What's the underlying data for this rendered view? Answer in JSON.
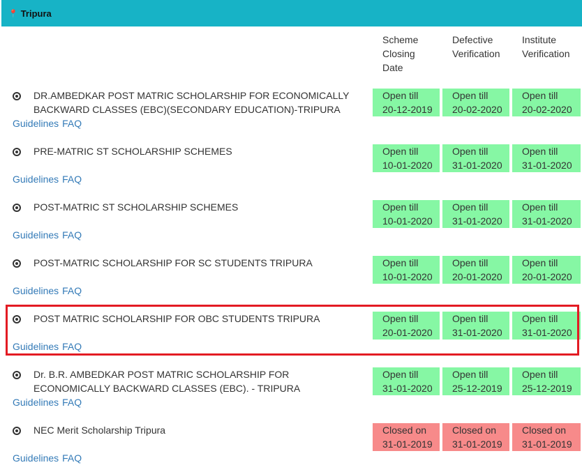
{
  "header": {
    "title": "Tripura",
    "icon": "map-pin-icon"
  },
  "columns": [
    "Scheme Closing Date",
    "Defective Verification",
    "Institute Verification"
  ],
  "column_lines": [
    [
      "Scheme",
      "Closing",
      "Date"
    ],
    [
      "Defective",
      "Verification"
    ],
    [
      "Institute",
      "Verification"
    ]
  ],
  "links": {
    "guidelines": "Guidelines",
    "faq": "FAQ"
  },
  "schemes": [
    {
      "title": "DR.AMBEDKAR POST MATRIC SCHOLARSHIP FOR ECONOMICALLY BACKWARD CLASSES (EBC)(SECONDARY EDUCATION)-TRIPURA",
      "status": [
        [
          "Open till",
          "20-12-2019"
        ],
        [
          "Open till",
          "20-02-2020"
        ],
        [
          "Open till",
          "20-02-2020"
        ]
      ],
      "state": "open"
    },
    {
      "title": "PRE-MATRIC ST SCHOLARSHIP SCHEMES",
      "status": [
        [
          "Open till",
          "10-01-2020"
        ],
        [
          "Open till",
          "31-01-2020"
        ],
        [
          "Open till",
          "31-01-2020"
        ]
      ],
      "state": "open"
    },
    {
      "title": "POST-MATRIC ST SCHOLARSHIP SCHEMES",
      "status": [
        [
          "Open till",
          "10-01-2020"
        ],
        [
          "Open till",
          "31-01-2020"
        ],
        [
          "Open till",
          "31-01-2020"
        ]
      ],
      "state": "open"
    },
    {
      "title": "POST-MATRIC SCHOLARSHIP FOR SC STUDENTS TRIPURA",
      "status": [
        [
          "Open till",
          "10-01-2020"
        ],
        [
          "Open till",
          "20-01-2020"
        ],
        [
          "Open till",
          "20-01-2020"
        ]
      ],
      "state": "open"
    },
    {
      "title": "POST MATRIC SCHOLARSHIP FOR OBC STUDENTS TRIPURA",
      "status": [
        [
          "Open till",
          "20-01-2020"
        ],
        [
          "Open till",
          "31-01-2020"
        ],
        [
          "Open till",
          "31-01-2020"
        ]
      ],
      "state": "open"
    },
    {
      "title": "Dr. B.R. AMBEDKAR POST MATRIC SCHOLARSHIP FOR ECONOMICALLY BACKWARD CLASSES (EBC). - TRIPURA",
      "status": [
        [
          "Open till",
          "31-01-2020"
        ],
        [
          "Open till",
          "25-12-2019"
        ],
        [
          "Open till",
          "25-12-2019"
        ]
      ],
      "state": "open"
    },
    {
      "title": "NEC Merit Scholarship Tripura",
      "status": [
        [
          "Closed on",
          "31-01-2019"
        ],
        [
          "Closed on",
          "31-01-2019"
        ],
        [
          "Closed on",
          "31-01-2019"
        ]
      ],
      "state": "closed"
    }
  ],
  "colors": {
    "header": "#17b3c6",
    "open": "#86f7a4",
    "closed": "#f78a8a",
    "link": "#337ab7",
    "highlight": "#e31b23"
  }
}
